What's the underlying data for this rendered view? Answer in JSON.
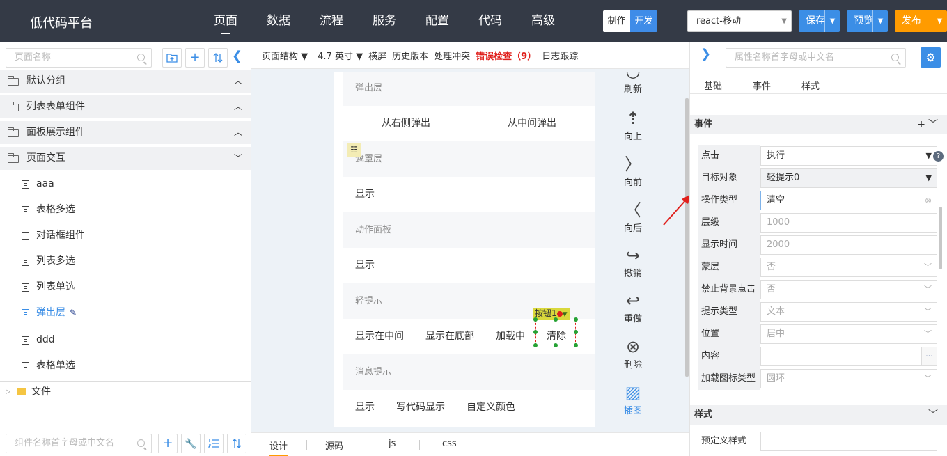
{
  "topbar": {
    "brand": "低代码平台",
    "nav": [
      "页面",
      "数据",
      "流程",
      "服务",
      "配置",
      "代码",
      "高级"
    ],
    "mode": {
      "make": "制作",
      "dev": "开发"
    },
    "env": "react-移动",
    "save": "保存",
    "preview": "预览",
    "publish": "发布"
  },
  "left": {
    "search_placeholder": "页面名称",
    "groups": [
      "默认分组",
      "列表表单组件",
      "面板展示组件",
      "页面交互"
    ],
    "pages": [
      "aaa",
      "表格多选",
      "对话框组件",
      "列表多选",
      "列表单选",
      "弹出层",
      "ddd",
      "表格单选"
    ],
    "files": "文件",
    "bottom_search_placeholder": "组件名称首字母或中文名"
  },
  "toolbar": {
    "structure": "页面结构",
    "device": "4.7 英寸",
    "landscape": "横屏",
    "history": "历史版本",
    "conflict": "处理冲突",
    "errors": "错误检查（9）",
    "log": "日志跟踪"
  },
  "canvas": {
    "sec1": "弹出层",
    "row1": [
      "从右侧弹出",
      "从中间弹出"
    ],
    "sec2": "遮罩层",
    "row2": [
      "显示"
    ],
    "sec3": "动作面板",
    "row3": [
      "显示"
    ],
    "sec4": "轻提示",
    "row4": [
      "显示在中间",
      "显示在底部",
      "加载中",
      "清除"
    ],
    "tag": "按钮1",
    "sec5": "消息提示",
    "row5": [
      "显示",
      "写代码显示",
      "自定义颜色"
    ]
  },
  "tools": [
    "刷新",
    "向上",
    "向前",
    "向后",
    "撤销",
    "重做",
    "删除",
    "插图"
  ],
  "bottom_tabs": [
    "设计",
    "源码",
    "js",
    "css"
  ],
  "right": {
    "search_placeholder": "属性名称首字母或中文名",
    "tabs": [
      "基础",
      "事件",
      "样式"
    ],
    "events_header": "事件",
    "props": [
      {
        "label": "点击",
        "value": "执行"
      },
      {
        "label": "目标对象",
        "value": "轻提示0"
      },
      {
        "label": "操作类型",
        "value": "清空"
      },
      {
        "label": "层级",
        "value": "1000"
      },
      {
        "label": "显示时间",
        "value": "2000"
      },
      {
        "label": "蒙层",
        "value": "否"
      },
      {
        "label": "禁止背景点击",
        "value": "否"
      },
      {
        "label": "提示类型",
        "value": "文本"
      },
      {
        "label": "位置",
        "value": "居中"
      },
      {
        "label": "内容",
        "value": ""
      },
      {
        "label": "加载图标类型",
        "value": "圆环"
      }
    ],
    "style_header": "样式",
    "preset_style": "预定义样式"
  },
  "colors": {
    "topbar": "#343a46",
    "accent": "#3b8ee6",
    "publish": "#ff9b00",
    "error": "#e0201c",
    "handle": "#26a234"
  }
}
